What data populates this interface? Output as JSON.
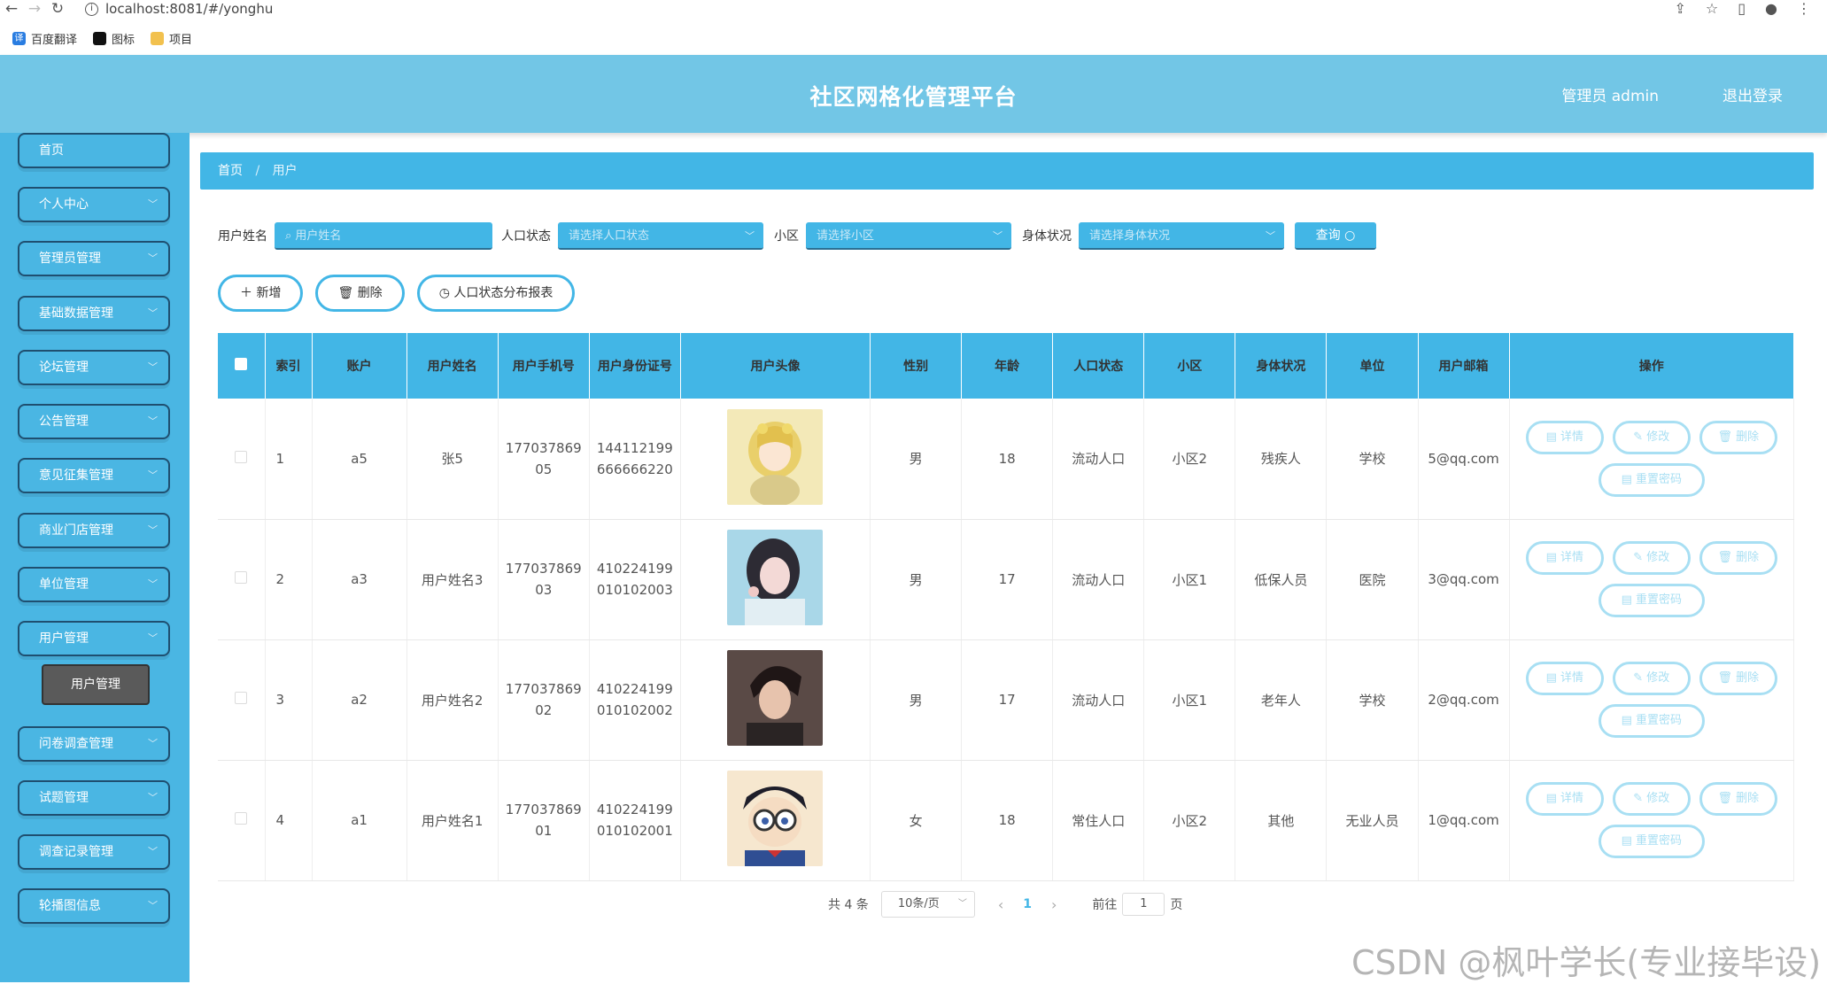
{
  "browser": {
    "url": "localhost:8081/#/yonghu",
    "bookmarks": [
      {
        "label": "百度翻译",
        "icon": "translate-icon"
      },
      {
        "label": "图标",
        "icon": "bookmark-icon"
      },
      {
        "label": "项目",
        "icon": "folder-icon"
      }
    ]
  },
  "header": {
    "title": "社区网格化管理平台",
    "user": "管理员 admin",
    "logout": "退出登录"
  },
  "sidebar": {
    "items": [
      {
        "label": "首页",
        "expandable": false
      },
      {
        "label": "个人中心",
        "expandable": true
      },
      {
        "label": "管理员管理",
        "expandable": true
      },
      {
        "label": "基础数据管理",
        "expandable": true
      },
      {
        "label": "论坛管理",
        "expandable": true
      },
      {
        "label": "公告管理",
        "expandable": true
      },
      {
        "label": "意见征集管理",
        "expandable": true
      },
      {
        "label": "商业门店管理",
        "expandable": true
      },
      {
        "label": "单位管理",
        "expandable": true
      },
      {
        "label": "用户管理",
        "expandable": true
      },
      {
        "label": "问卷调查管理",
        "expandable": true
      },
      {
        "label": "试题管理",
        "expandable": true
      },
      {
        "label": "调查记录管理",
        "expandable": true
      },
      {
        "label": "轮播图信息",
        "expandable": true
      }
    ],
    "submenu": {
      "label": "用户管理"
    }
  },
  "breadcrumb": {
    "home": "首页",
    "separator": "/",
    "current": "用户"
  },
  "search": {
    "name_label": "用户姓名",
    "name_placeholder": "用户姓名",
    "status_label": "人口状态",
    "status_placeholder": "请选择人口状态",
    "district_label": "小区",
    "district_placeholder": "请选择小区",
    "health_label": "身体状况",
    "health_placeholder": "请选择身体状况",
    "query_label": "查询"
  },
  "actions": {
    "add": "新增",
    "delete": "删除",
    "report": "人口状态分布报表"
  },
  "table": {
    "headers": [
      "索引",
      "账户",
      "用户姓名",
      "用户手机号",
      "用户身份证号",
      "用户头像",
      "性别",
      "年龄",
      "人口状态",
      "小区",
      "身体状况",
      "单位",
      "用户邮箱",
      "操作"
    ],
    "rows": [
      {
        "index": "1",
        "account": "a5",
        "name": "张5",
        "phone": "17703786905",
        "idcard": "144112199666666220",
        "avatar": "anime-girl-blonde",
        "gender": "男",
        "age": "18",
        "status": "流动人口",
        "district": "小区2",
        "health": "残疾人",
        "unit": "学校",
        "email": "5@qq.com"
      },
      {
        "index": "2",
        "account": "a3",
        "name": "用户姓名3",
        "phone": "17703786903",
        "idcard": "410224199010102003",
        "avatar": "girl-portrait",
        "gender": "男",
        "age": "17",
        "status": "流动人口",
        "district": "小区1",
        "health": "低保人员",
        "unit": "医院",
        "email": "3@qq.com"
      },
      {
        "index": "3",
        "account": "a2",
        "name": "用户姓名2",
        "phone": "17703786902",
        "idcard": "410224199010102002",
        "avatar": "boy-portrait",
        "gender": "男",
        "age": "17",
        "status": "流动人口",
        "district": "小区1",
        "health": "老年人",
        "unit": "学校",
        "email": "2@qq.com"
      },
      {
        "index": "4",
        "account": "a1",
        "name": "用户姓名1",
        "phone": "17703786901",
        "idcard": "410224199010102001",
        "avatar": "cartoon-boy-glasses",
        "gender": "女",
        "age": "18",
        "status": "常住人口",
        "district": "小区2",
        "health": "其他",
        "unit": "无业人员",
        "email": "1@qq.com"
      }
    ],
    "op_labels": {
      "detail": "详情",
      "edit": "修改",
      "delete": "删除",
      "reset": "重置密码"
    }
  },
  "pagination": {
    "total": "共 4 条",
    "page_size": "10条/页",
    "current_page": "1",
    "goto_label": "前往",
    "goto_value": "1",
    "page_suffix": "页"
  },
  "watermark": "CSDN @枫叶学长(专业接毕设)",
  "colors": {
    "header": "#72c6e6",
    "sidebar": "#4ab6e3",
    "accent": "#42b6e6",
    "op_button": "#a8dff3"
  }
}
